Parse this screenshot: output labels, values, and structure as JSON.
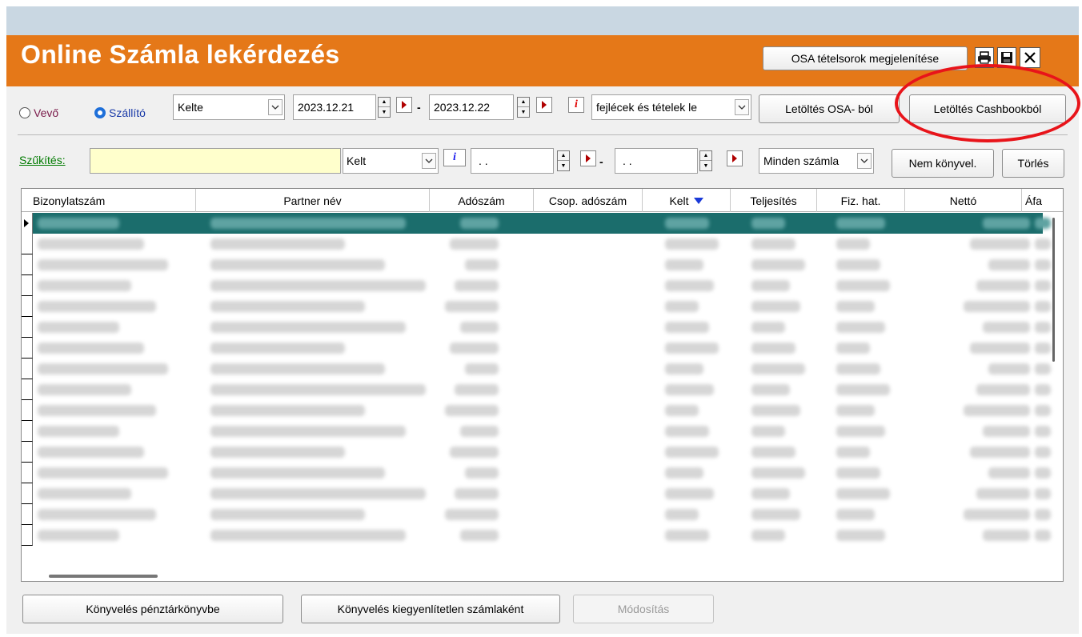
{
  "window": {
    "title": "Online Számla lekérdezés",
    "buttons": {
      "osa_lines": "OSA tételsorok megjelenítése",
      "print_icon": "printer-icon",
      "save_icon": "floppy-disk-icon",
      "close_icon": "close-icon"
    }
  },
  "filters": {
    "radio_buyer": "Vevő",
    "radio_supplier": "Szállító",
    "selected_radio": "Szállító",
    "date_type": "Kelte",
    "date_from": "2023.12.21",
    "dash": "-",
    "date_to": "2023.12.22",
    "info_red": "i",
    "content_select": "fejlécek és tételek le",
    "download_osa": "Letöltés OSA- ból",
    "download_cashbook": "Letöltés Cashbookból"
  },
  "narrowing": {
    "label": "Szűkítés:",
    "input_value": "",
    "field_select": "Kelt",
    "info_blue": "i",
    "date_from": ". .",
    "dash": "-",
    "date_to": ". .",
    "invoice_filter": "Minden számla",
    "not_booked": "Nem könyvel.",
    "delete": "Törlés"
  },
  "table": {
    "columns": [
      "Bizonylatszám",
      "Partner név",
      "Adószám",
      "Csop. adószám",
      "Kelt",
      "Teljesítés",
      "Fiz. hat.",
      "Nettó",
      "Áfa"
    ],
    "sort_column": "Kelt",
    "sort_direction": "descending",
    "row_count": 16
  },
  "footer": {
    "book_cashbook": "Könyvelés pénztárkönyvbe",
    "book_unpaid": "Könyvelés kiegyenlítetlen számlaként",
    "modify": "Módosítás"
  },
  "colors": {
    "title_bar": "#e57818",
    "selected_row": "#1b6d6c",
    "highlight_circle": "#e8141a",
    "narrow_input": "#ffffcc"
  }
}
